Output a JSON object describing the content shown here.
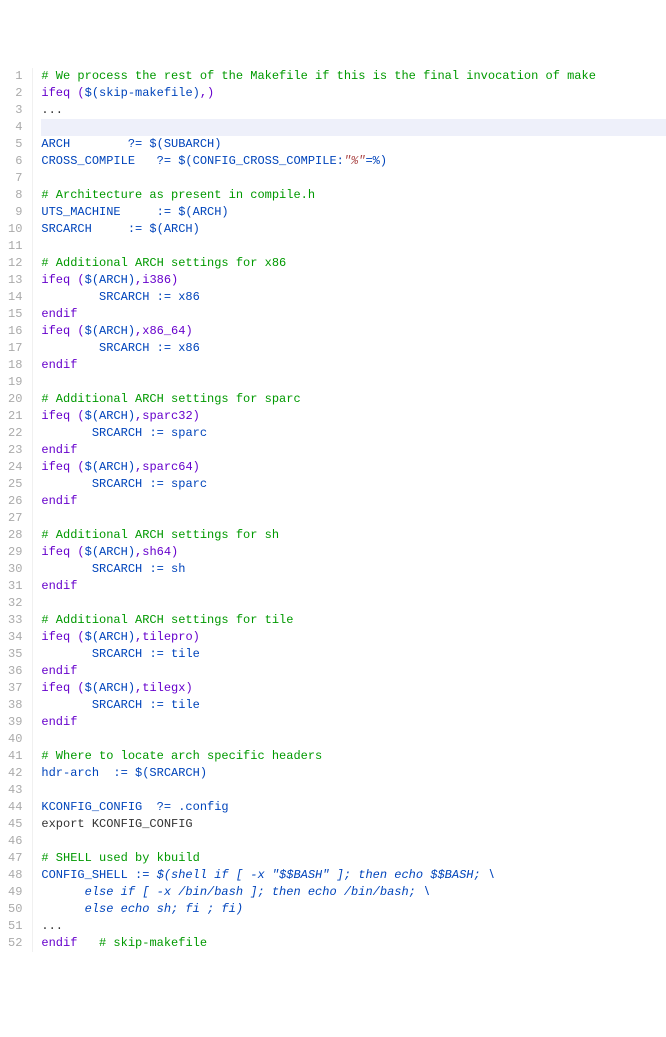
{
  "lines": [
    {
      "n": "1",
      "segs": [
        {
          "cls": "c",
          "t": "# We process the rest of the Makefile if this is the final invocation of make"
        }
      ]
    },
    {
      "n": "2",
      "segs": [
        {
          "cls": "k",
          "t": "ifeq ("
        },
        {
          "cls": "v",
          "t": "$(skip-makefile)"
        },
        {
          "cls": "k",
          "t": ",)"
        }
      ]
    },
    {
      "n": "3",
      "segs": [
        {
          "cls": "p",
          "t": "..."
        }
      ]
    },
    {
      "n": "4",
      "hl": true,
      "segs": [
        {
          "cls": "p",
          "t": ""
        }
      ]
    },
    {
      "n": "5",
      "segs": [
        {
          "cls": "v",
          "t": "ARCH        ?= $(SUBARCH)"
        }
      ]
    },
    {
      "n": "6",
      "segs": [
        {
          "cls": "v",
          "t": "CROSS_COMPILE   ?= $(CONFIG_CROSS_COMPILE:"
        },
        {
          "cls": "s",
          "t": "\"%\""
        },
        {
          "cls": "v",
          "t": "=%)"
        }
      ]
    },
    {
      "n": "7",
      "segs": [
        {
          "cls": "p",
          "t": ""
        }
      ]
    },
    {
      "n": "8",
      "segs": [
        {
          "cls": "c",
          "t": "# Architecture as present in compile.h"
        }
      ]
    },
    {
      "n": "9",
      "segs": [
        {
          "cls": "v",
          "t": "UTS_MACHINE     := $(ARCH)"
        }
      ]
    },
    {
      "n": "10",
      "segs": [
        {
          "cls": "v",
          "t": "SRCARCH     := $(ARCH)"
        }
      ]
    },
    {
      "n": "11",
      "segs": [
        {
          "cls": "p",
          "t": ""
        }
      ]
    },
    {
      "n": "12",
      "segs": [
        {
          "cls": "c",
          "t": "# Additional ARCH settings for x86"
        }
      ]
    },
    {
      "n": "13",
      "segs": [
        {
          "cls": "k",
          "t": "ifeq ("
        },
        {
          "cls": "v",
          "t": "$(ARCH)"
        },
        {
          "cls": "k",
          "t": ",i386)"
        }
      ]
    },
    {
      "n": "14",
      "segs": [
        {
          "cls": "p",
          "t": "        "
        },
        {
          "cls": "v",
          "t": "SRCARCH := x86"
        }
      ]
    },
    {
      "n": "15",
      "segs": [
        {
          "cls": "k",
          "t": "endif"
        }
      ]
    },
    {
      "n": "16",
      "segs": [
        {
          "cls": "k",
          "t": "ifeq ("
        },
        {
          "cls": "v",
          "t": "$(ARCH)"
        },
        {
          "cls": "k",
          "t": ",x86_64)"
        }
      ]
    },
    {
      "n": "17",
      "segs": [
        {
          "cls": "p",
          "t": "        "
        },
        {
          "cls": "v",
          "t": "SRCARCH := x86"
        }
      ]
    },
    {
      "n": "18",
      "segs": [
        {
          "cls": "k",
          "t": "endif"
        }
      ]
    },
    {
      "n": "19",
      "segs": [
        {
          "cls": "p",
          "t": ""
        }
      ]
    },
    {
      "n": "20",
      "segs": [
        {
          "cls": "c",
          "t": "# Additional ARCH settings for sparc"
        }
      ]
    },
    {
      "n": "21",
      "segs": [
        {
          "cls": "k",
          "t": "ifeq ("
        },
        {
          "cls": "v",
          "t": "$(ARCH)"
        },
        {
          "cls": "k",
          "t": ",sparc32)"
        }
      ]
    },
    {
      "n": "22",
      "segs": [
        {
          "cls": "p",
          "t": "       "
        },
        {
          "cls": "v",
          "t": "SRCARCH := sparc"
        }
      ]
    },
    {
      "n": "23",
      "segs": [
        {
          "cls": "k",
          "t": "endif"
        }
      ]
    },
    {
      "n": "24",
      "segs": [
        {
          "cls": "k",
          "t": "ifeq ("
        },
        {
          "cls": "v",
          "t": "$(ARCH)"
        },
        {
          "cls": "k",
          "t": ",sparc64)"
        }
      ]
    },
    {
      "n": "25",
      "segs": [
        {
          "cls": "p",
          "t": "       "
        },
        {
          "cls": "v",
          "t": "SRCARCH := sparc"
        }
      ]
    },
    {
      "n": "26",
      "segs": [
        {
          "cls": "k",
          "t": "endif"
        }
      ]
    },
    {
      "n": "27",
      "segs": [
        {
          "cls": "p",
          "t": ""
        }
      ]
    },
    {
      "n": "28",
      "segs": [
        {
          "cls": "c",
          "t": "# Additional ARCH settings for sh"
        }
      ]
    },
    {
      "n": "29",
      "segs": [
        {
          "cls": "k",
          "t": "ifeq ("
        },
        {
          "cls": "v",
          "t": "$(ARCH)"
        },
        {
          "cls": "k",
          "t": ",sh64)"
        }
      ]
    },
    {
      "n": "30",
      "segs": [
        {
          "cls": "p",
          "t": "       "
        },
        {
          "cls": "v",
          "t": "SRCARCH := sh"
        }
      ]
    },
    {
      "n": "31",
      "segs": [
        {
          "cls": "k",
          "t": "endif"
        }
      ]
    },
    {
      "n": "32",
      "segs": [
        {
          "cls": "p",
          "t": ""
        }
      ]
    },
    {
      "n": "33",
      "segs": [
        {
          "cls": "c",
          "t": "# Additional ARCH settings for tile"
        }
      ]
    },
    {
      "n": "34",
      "segs": [
        {
          "cls": "k",
          "t": "ifeq ("
        },
        {
          "cls": "v",
          "t": "$(ARCH)"
        },
        {
          "cls": "k",
          "t": ",tilepro)"
        }
      ]
    },
    {
      "n": "35",
      "segs": [
        {
          "cls": "p",
          "t": "       "
        },
        {
          "cls": "v",
          "t": "SRCARCH := tile"
        }
      ]
    },
    {
      "n": "36",
      "segs": [
        {
          "cls": "k",
          "t": "endif"
        }
      ]
    },
    {
      "n": "37",
      "segs": [
        {
          "cls": "k",
          "t": "ifeq ("
        },
        {
          "cls": "v",
          "t": "$(ARCH)"
        },
        {
          "cls": "k",
          "t": ",tilegx)"
        }
      ]
    },
    {
      "n": "38",
      "segs": [
        {
          "cls": "p",
          "t": "       "
        },
        {
          "cls": "v",
          "t": "SRCARCH := tile"
        }
      ]
    },
    {
      "n": "39",
      "segs": [
        {
          "cls": "k",
          "t": "endif"
        }
      ]
    },
    {
      "n": "40",
      "segs": [
        {
          "cls": "p",
          "t": ""
        }
      ]
    },
    {
      "n": "41",
      "segs": [
        {
          "cls": "c",
          "t": "# Where to locate arch specific headers"
        }
      ]
    },
    {
      "n": "42",
      "segs": [
        {
          "cls": "v",
          "t": "hdr-arch  := $(SRCARCH)"
        }
      ]
    },
    {
      "n": "43",
      "segs": [
        {
          "cls": "p",
          "t": ""
        }
      ]
    },
    {
      "n": "44",
      "segs": [
        {
          "cls": "v",
          "t": "KCONFIG_CONFIG  ?= .config"
        }
      ]
    },
    {
      "n": "45",
      "segs": [
        {
          "cls": "p",
          "t": "export KCONFIG_CONFIG"
        }
      ]
    },
    {
      "n": "46",
      "segs": [
        {
          "cls": "p",
          "t": ""
        }
      ]
    },
    {
      "n": "47",
      "segs": [
        {
          "cls": "c",
          "t": "# SHELL used by kbuild"
        }
      ]
    },
    {
      "n": "48",
      "segs": [
        {
          "cls": "v",
          "t": "CONFIG_SHELL := "
        },
        {
          "cls": "f",
          "t": "$(shell if [ -x \"$$BASH\" ]; then echo $$BASH; \\"
        }
      ]
    },
    {
      "n": "49",
      "segs": [
        {
          "cls": "f",
          "t": "      else if [ -x /bin/bash ]; then echo /bin/bash; \\"
        }
      ]
    },
    {
      "n": "50",
      "segs": [
        {
          "cls": "f",
          "t": "      else echo sh; fi ; fi)"
        }
      ]
    },
    {
      "n": "51",
      "segs": [
        {
          "cls": "p",
          "t": "..."
        }
      ]
    },
    {
      "n": "52",
      "segs": [
        {
          "cls": "k",
          "t": "endif"
        },
        {
          "cls": "p",
          "t": "   "
        },
        {
          "cls": "c",
          "t": "# skip-makefile"
        }
      ]
    }
  ]
}
